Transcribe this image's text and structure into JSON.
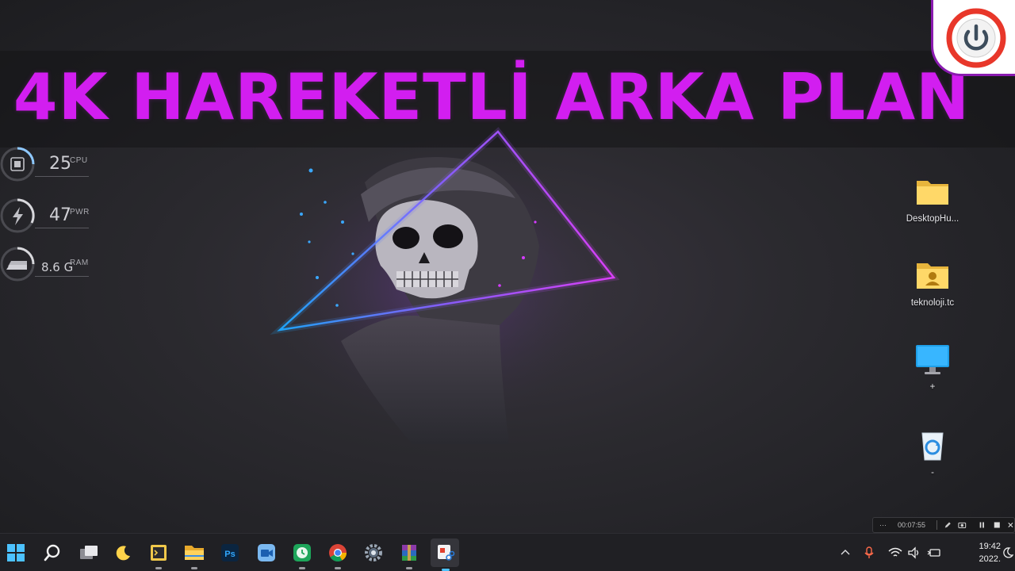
{
  "banner": {
    "title": "4K HAREKETLİ ARKA PLAN"
  },
  "gauges": [
    {
      "value": "25",
      "unit": "CPU",
      "icon": "cpu-icon",
      "level": 0.25
    },
    {
      "value": "47",
      "unit": "PWR",
      "icon": "power-bolt-icon",
      "level": 0.47
    },
    {
      "value": "8.6 G",
      "unit": "RAM",
      "icon": "ram-icon",
      "level": 0.55
    }
  ],
  "desktop_icons": [
    {
      "label": "DesktopHu...",
      "icon": "folder-icon"
    },
    {
      "label": "teknoloji.tc",
      "icon": "user-folder-icon"
    },
    {
      "label": "+",
      "icon": "monitor-icon"
    },
    {
      "label": "-",
      "icon": "recycle-bin-icon"
    }
  ],
  "recorder": {
    "menu": "···",
    "time": "00:07:55"
  },
  "taskbar": {
    "apps": [
      "start-icon",
      "search-icon",
      "task-view-icon",
      "moon-app-icon",
      "terminal-app-icon",
      "file-explorer-icon",
      "photoshop-icon",
      "meet-app-icon",
      "clock-app-icon",
      "chrome-icon",
      "settings-icon",
      "winrar-icon",
      "snipping-tool-icon"
    ],
    "photoshop_label": "Ps"
  },
  "clock": {
    "time": "19:42",
    "date": "2022."
  },
  "colors": {
    "accent": "#d21ef0",
    "neon_blue": "#1ea8ff",
    "neon_pink": "#d63cff"
  }
}
